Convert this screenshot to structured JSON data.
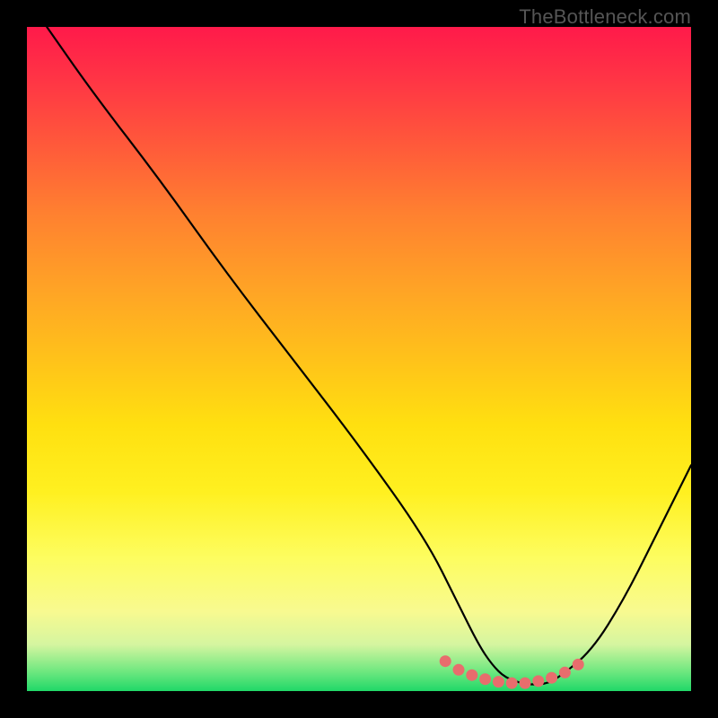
{
  "watermark": "TheBottleneck.com",
  "chart_data": {
    "type": "line",
    "title": "",
    "xlabel": "",
    "ylabel": "",
    "xlim": [
      0,
      100
    ],
    "ylim": [
      0,
      100
    ],
    "series": [
      {
        "name": "bottleneck-curve",
        "x": [
          3,
          10,
          20,
          30,
          40,
          50,
          60,
          65,
          68,
          70,
          72,
          75,
          78,
          80,
          85,
          90,
          95,
          100
        ],
        "values": [
          100,
          90,
          77,
          63,
          50,
          37,
          23,
          13,
          7,
          4,
          2,
          1,
          1,
          2,
          6,
          14,
          24,
          34
        ]
      }
    ],
    "markers": {
      "name": "optimal-range",
      "x": [
        63,
        65,
        67,
        69,
        71,
        73,
        75,
        77,
        79,
        81,
        83
      ],
      "values": [
        4.5,
        3.2,
        2.4,
        1.8,
        1.4,
        1.2,
        1.2,
        1.5,
        2.0,
        2.8,
        4.0
      ],
      "color": "#e86d6d"
    },
    "background": "red-yellow-green-gradient"
  }
}
